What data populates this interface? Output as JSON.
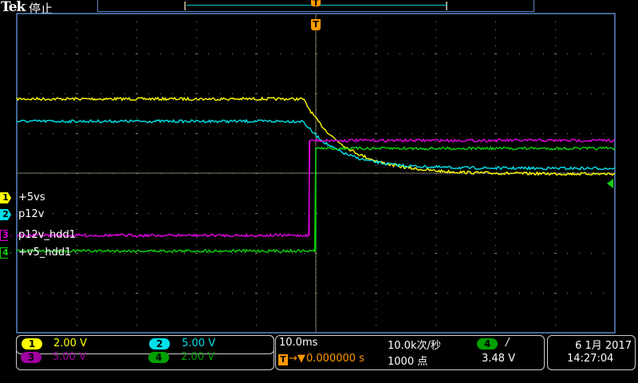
{
  "header": {
    "brand": "Tek",
    "run_state": "停止"
  },
  "colors": {
    "ch1": "#ffff00",
    "ch2": "#00e0e8",
    "ch3": "#e000e0",
    "ch4": "#10d010",
    "ch3_text": "#a000a0",
    "ch4_text": "#00a000",
    "trigger": "#ff9900",
    "grid": "#888070",
    "frame": "#5b87c5"
  },
  "channels": [
    {
      "id": "1",
      "name": "+5vs",
      "scale": "2.00 V",
      "volts_per_div": 2
    },
    {
      "id": "2",
      "name": "p12v",
      "scale": "5.00 V",
      "volts_per_div": 5
    },
    {
      "id": "3",
      "name": "p12v_hdd1",
      "scale": "5.00 V",
      "volts_per_div": 5
    },
    {
      "id": "4",
      "name": "+v5_hdd1",
      "scale": "2.00 V",
      "volts_per_div": 2
    }
  ],
  "waveforms": [
    {
      "channel": "1",
      "type": "decay",
      "v_before": 4.96,
      "v_after": 1.2,
      "t_start_ms": -2.1,
      "tau_ms": 7
    },
    {
      "channel": "2",
      "type": "decay",
      "v_before": 11.7,
      "v_after": 5.8,
      "t_start_ms": -2.1,
      "tau_ms": 6
    },
    {
      "channel": "3",
      "type": "step",
      "v_before": 0,
      "v_after": 11.9,
      "t_start_ms": -1.1
    },
    {
      "channel": "4",
      "type": "step",
      "v_before": 0.1,
      "v_after": 5.24,
      "t_start_ms": 0
    }
  ],
  "horizontal": {
    "scale": "10.0ms",
    "ms_per_div": 10,
    "trigger_delay": "0.000000 s",
    "sample_rate": "10.0k次/秒",
    "record_length": "1000 点"
  },
  "trigger": {
    "source": "4",
    "slope": "/",
    "level": "3.48 V",
    "level_volts": 3.48,
    "marker": "T"
  },
  "datetime": {
    "date": "6 1月 2017",
    "time": "14:27:04"
  }
}
